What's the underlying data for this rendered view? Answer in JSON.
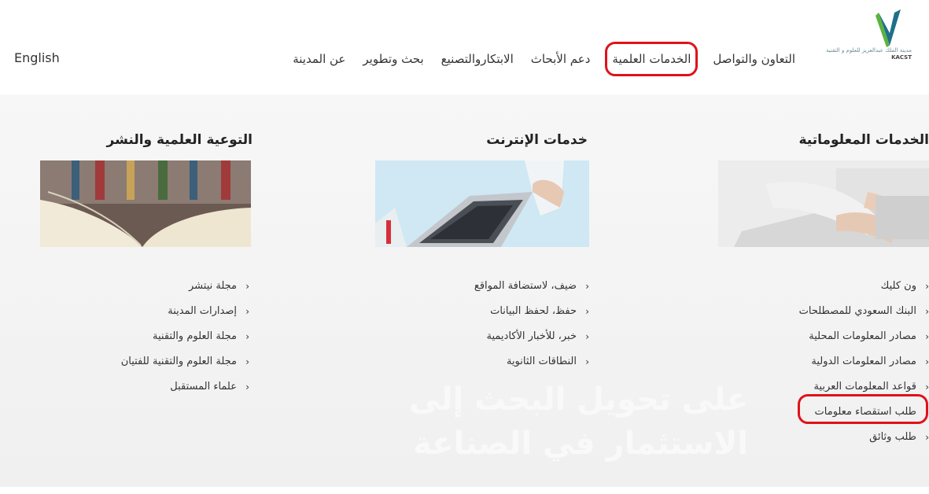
{
  "brand": {
    "logo_text_ar": "مدينة الملك عبدالعزيز للعلوم و التقنية",
    "logo_text_en": "KACST"
  },
  "nav": {
    "items": [
      "عن المدينة",
      "بحث وتطوير",
      "الابتكاروالتصنيع",
      "دعم الأبحاث",
      "الخدمات العلمية",
      "التعاون والتواصل"
    ],
    "language": "English",
    "highlighted_item": "الخدمات العلمية"
  },
  "columns": [
    {
      "title": "الخدمات المعلوماتية",
      "image_icon": "laptop-typing-image",
      "items": [
        "ون كليك",
        "البنك السعودي للمصطلحات",
        "مصادر المعلومات المحلية",
        "مصادر المعلومات الدولية",
        "قواعد المعلومات العربية",
        "طلب استقصاء معلومات",
        "طلب وثائق"
      ],
      "highlighted_item": "طلب استقصاء معلومات"
    },
    {
      "title": "خدمات الإنترنت",
      "image_icon": "laptop-image",
      "items": [
        "ضيف، لاستضافة المواقع",
        "حفظ، لحفظ البيانات",
        "خبر، للأخبار الأكاديمية",
        "النطاقات الثانوية"
      ]
    },
    {
      "title": "التوعية العلمية والنشر",
      "image_icon": "open-book-image",
      "items": [
        "مجلة نيتشر",
        "إصدارات المدينة",
        "مجلة العلوم والتقنية",
        "مجلة العلوم والتقنية للفتيان",
        "علماء المستقبل"
      ]
    }
  ],
  "watermark": {
    "line1": "على تحويل البحث إلى",
    "line2": "الاستثمار في الصناعة"
  },
  "colors": {
    "highlight": "#e0121a",
    "logo_green": "#5bb33e",
    "logo_blue": "#1f6f8b"
  }
}
